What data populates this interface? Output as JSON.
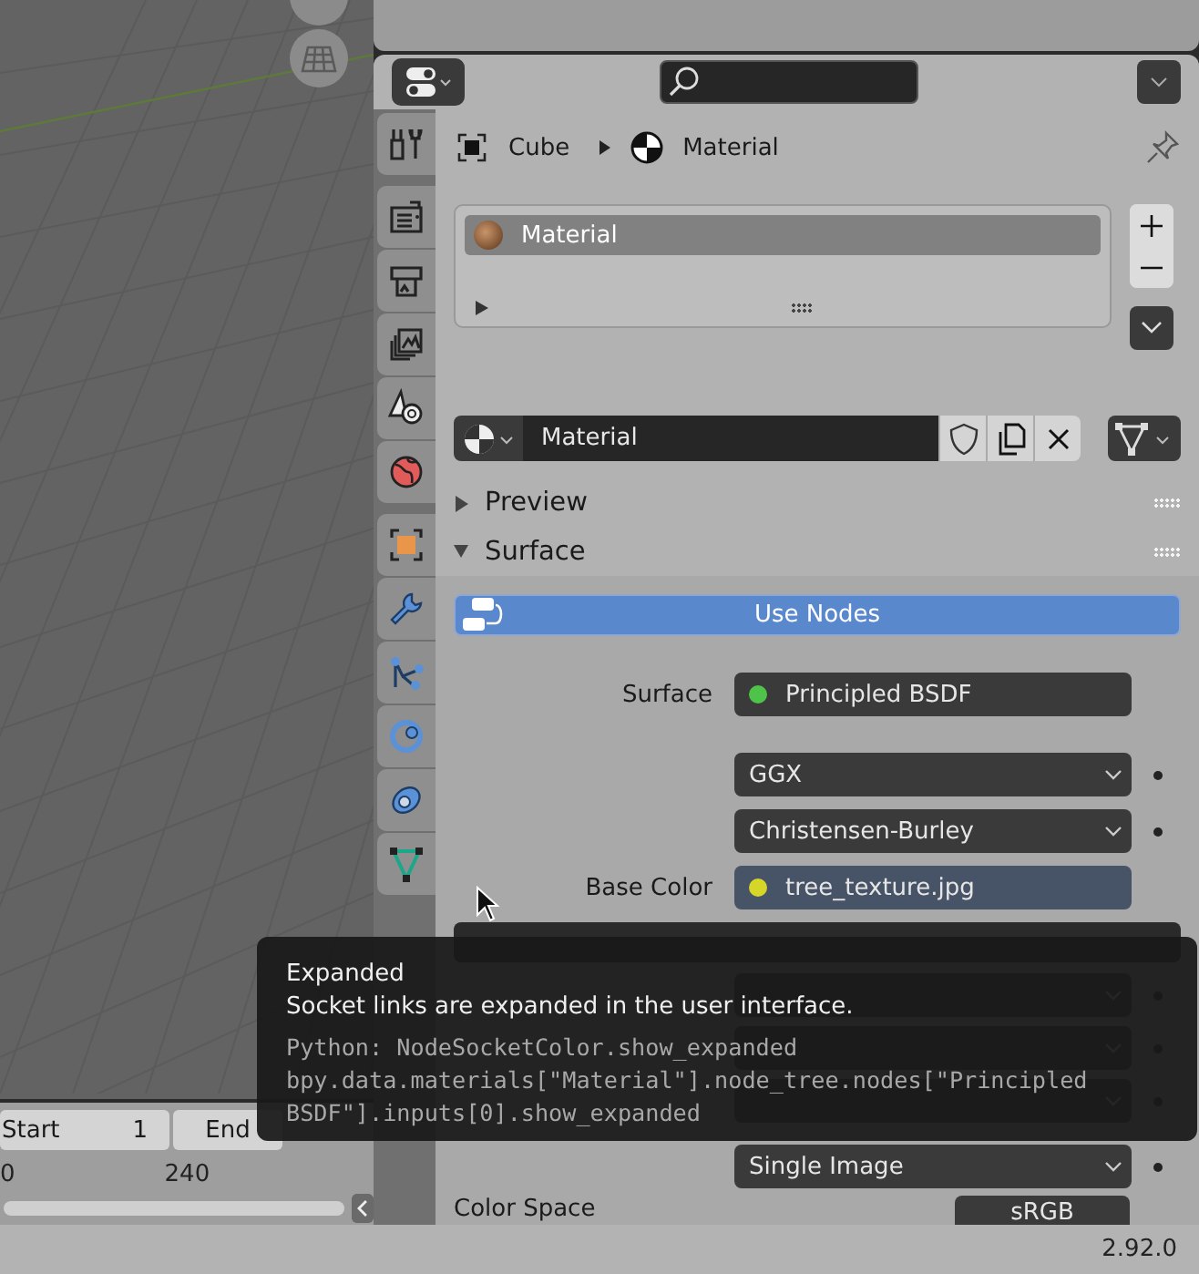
{
  "timeline": {
    "fields": [
      {
        "label": "Start",
        "value": "1"
      },
      {
        "label": "End"
      }
    ],
    "ruler": [
      "0",
      "240"
    ]
  },
  "properties": {
    "tab_groups": [
      [
        {
          "kind": "tool"
        }
      ],
      [
        {
          "kind": "render"
        },
        {
          "kind": "output"
        },
        {
          "kind": "view_layer"
        },
        {
          "kind": "scene"
        },
        {
          "kind": "world"
        }
      ],
      [
        {
          "kind": "object"
        },
        {
          "kind": "modifiers"
        },
        {
          "kind": "particles"
        },
        {
          "kind": "physics"
        },
        {
          "kind": "constraints"
        },
        {
          "kind": "data"
        }
      ]
    ],
    "breadcrumb": [
      "Cube",
      "Material"
    ],
    "material_slots": [
      {
        "name": "Material",
        "selected": true
      }
    ],
    "material_selector": {
      "value": "Material"
    },
    "panels": [
      {
        "title": "Preview",
        "expanded": false
      },
      {
        "title": "Surface",
        "expanded": true
      }
    ],
    "use_nodes": {
      "label": "Use Nodes",
      "on": true
    },
    "rows": [
      {
        "kind": "socket",
        "label": "Surface",
        "value": "Principled BSDF",
        "color": "#4fc24a"
      },
      {
        "kind": "dropdown",
        "value": "GGX"
      },
      {
        "kind": "dropdown",
        "value": "Christensen-Burley"
      },
      {
        "kind": "socket",
        "label": "Base Color",
        "value": "tree_texture.jpg",
        "color": "#d6d629"
      },
      {
        "kind": "image"
      },
      {
        "kind": "dropdown"
      },
      {
        "kind": "dropdown"
      },
      {
        "kind": "dropdown"
      },
      {
        "kind": "dropdown",
        "value": "Single Image"
      },
      {
        "kind": "field",
        "label": "Color Space",
        "value": "sRGB"
      }
    ]
  },
  "tooltip": {
    "title": "Expanded",
    "description": "Socket links are expanded in the user interface.",
    "python": [
      "Python: NodeSocketColor.show_expanded",
      "bpy.data.materials[\"Material\"].node_tree.nodes[\"Principled",
      "BSDF\"].inputs[0].show_expanded"
    ]
  },
  "status_bar": {
    "version": "2.92.0"
  }
}
